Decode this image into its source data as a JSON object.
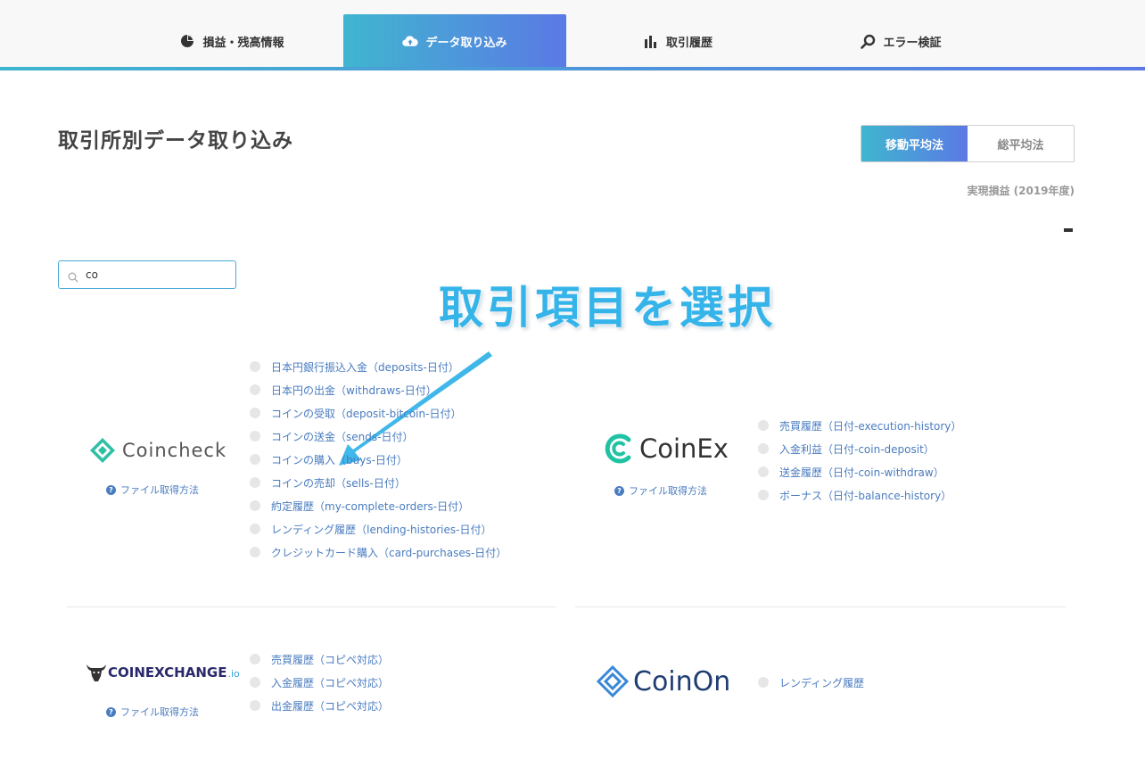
{
  "nav": {
    "tabs": [
      {
        "label": "損益・残高情報",
        "icon": "pie-chart-icon"
      },
      {
        "label": "データ取り込み",
        "icon": "cloud-upload-icon",
        "active": true
      },
      {
        "label": "取引履歴",
        "icon": "bar-chart-icon"
      },
      {
        "label": "エラー検証",
        "icon": "search-icon"
      }
    ]
  },
  "page": {
    "title": "取引所別データ取り込み"
  },
  "method_toggle": {
    "options": [
      "移動平均法",
      "総平均法"
    ],
    "selected": "移動平均法"
  },
  "profit": {
    "label": "実現損益 (2019年度)",
    "value": "-"
  },
  "search": {
    "value": "co",
    "icon": "search-icon"
  },
  "annotation": {
    "text": "取引項目を選択"
  },
  "help_label": "ファイル取得方法",
  "exchanges": [
    {
      "name": "Coincheck",
      "items": [
        "日本円銀行振込入金（deposits-日付）",
        "日本円の出金（withdraws-日付）",
        "コインの受取（deposit-bitcoin-日付）",
        "コインの送金（sends-日付）",
        "コインの購入（buys-日付）",
        "コインの売却（sells-日付）",
        "約定履歴（my-complete-orders-日付）",
        "レンディング履歴（lending-histories-日付）",
        "クレジットカード購入（card-purchases-日付）"
      ]
    },
    {
      "name": "CoinEx",
      "items": [
        "売買履歴（日付-execution-history）",
        "入金利益（日付-coin-deposit）",
        "送金履歴（日付-coin-withdraw）",
        "ボーナス（日付-balance-history）"
      ]
    },
    {
      "name_main": "COINEXCHANGE",
      "name_suffix": ".io",
      "items": [
        "売買履歴（コピペ対応）",
        "入金履歴（コピペ対応）",
        "出金履歴（コピペ対応）"
      ]
    },
    {
      "name": "CoinOn",
      "items": [
        "レンディング履歴"
      ]
    }
  ],
  "colors": {
    "accent_start": "#3fb6cf",
    "accent_end": "#5b79e5",
    "link": "#4a7cc0",
    "annotation": "#35b4ea"
  }
}
